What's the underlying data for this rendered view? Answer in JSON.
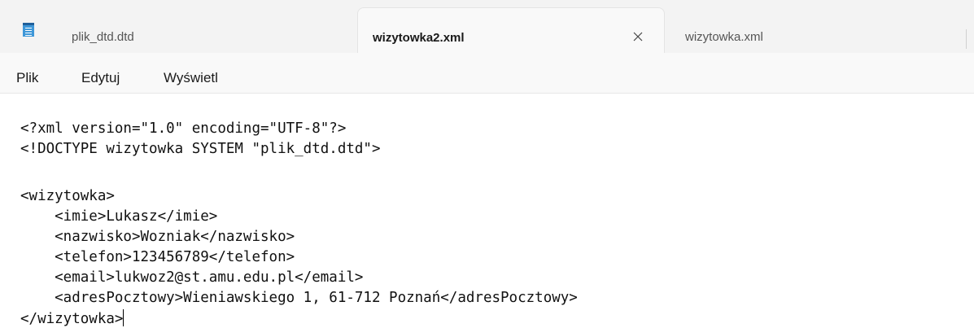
{
  "tabs": [
    {
      "label": "plik_dtd.dtd",
      "active": false
    },
    {
      "label": "wizytowka2.xml",
      "active": true
    },
    {
      "label": "wizytowka.xml",
      "active": false
    }
  ],
  "menu": [
    "Plik",
    "Edytuj",
    "Wyświetl"
  ],
  "editor": {
    "lines": [
      "<?xml version=\"1.0\" encoding=\"UTF-8\"?>",
      "<!DOCTYPE wizytowka SYSTEM \"plik_dtd.dtd\">",
      "",
      "<wizytowka>",
      "    <imie>Lukasz</imie>",
      "    <nazwisko>Wozniak</nazwisko>",
      "    <telefon>123456789</telefon>",
      "    <email>lukwoz2@st.amu.edu.pl</email>",
      "    <adresPocztowy>Wieniawskiego 1, 61-712 Poznań</adresPocztowy>",
      "</wizytowka>"
    ]
  },
  "icons": {
    "app": "notepad-icon",
    "close": "close-icon"
  }
}
